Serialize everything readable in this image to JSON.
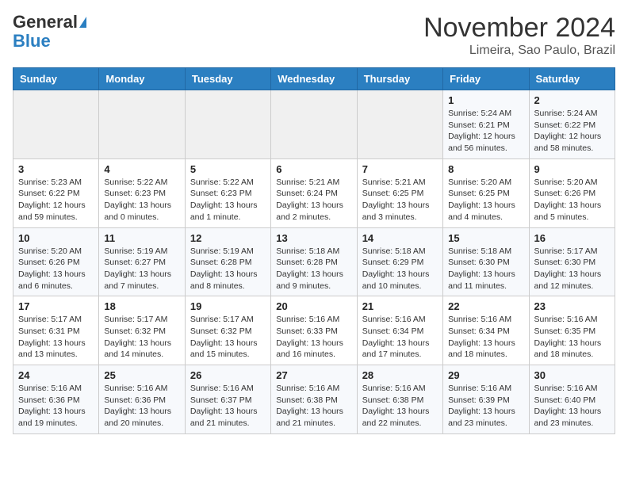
{
  "header": {
    "logo_line1": "General",
    "logo_line2": "Blue",
    "month": "November 2024",
    "location": "Limeira, Sao Paulo, Brazil"
  },
  "weekdays": [
    "Sunday",
    "Monday",
    "Tuesday",
    "Wednesday",
    "Thursday",
    "Friday",
    "Saturday"
  ],
  "weeks": [
    [
      {
        "day": "",
        "info": ""
      },
      {
        "day": "",
        "info": ""
      },
      {
        "day": "",
        "info": ""
      },
      {
        "day": "",
        "info": ""
      },
      {
        "day": "",
        "info": ""
      },
      {
        "day": "1",
        "info": "Sunrise: 5:24 AM\nSunset: 6:21 PM\nDaylight: 12 hours\nand 56 minutes."
      },
      {
        "day": "2",
        "info": "Sunrise: 5:24 AM\nSunset: 6:22 PM\nDaylight: 12 hours\nand 58 minutes."
      }
    ],
    [
      {
        "day": "3",
        "info": "Sunrise: 5:23 AM\nSunset: 6:22 PM\nDaylight: 12 hours\nand 59 minutes."
      },
      {
        "day": "4",
        "info": "Sunrise: 5:22 AM\nSunset: 6:23 PM\nDaylight: 13 hours\nand 0 minutes."
      },
      {
        "day": "5",
        "info": "Sunrise: 5:22 AM\nSunset: 6:23 PM\nDaylight: 13 hours\nand 1 minute."
      },
      {
        "day": "6",
        "info": "Sunrise: 5:21 AM\nSunset: 6:24 PM\nDaylight: 13 hours\nand 2 minutes."
      },
      {
        "day": "7",
        "info": "Sunrise: 5:21 AM\nSunset: 6:25 PM\nDaylight: 13 hours\nand 3 minutes."
      },
      {
        "day": "8",
        "info": "Sunrise: 5:20 AM\nSunset: 6:25 PM\nDaylight: 13 hours\nand 4 minutes."
      },
      {
        "day": "9",
        "info": "Sunrise: 5:20 AM\nSunset: 6:26 PM\nDaylight: 13 hours\nand 5 minutes."
      }
    ],
    [
      {
        "day": "10",
        "info": "Sunrise: 5:20 AM\nSunset: 6:26 PM\nDaylight: 13 hours\nand 6 minutes."
      },
      {
        "day": "11",
        "info": "Sunrise: 5:19 AM\nSunset: 6:27 PM\nDaylight: 13 hours\nand 7 minutes."
      },
      {
        "day": "12",
        "info": "Sunrise: 5:19 AM\nSunset: 6:28 PM\nDaylight: 13 hours\nand 8 minutes."
      },
      {
        "day": "13",
        "info": "Sunrise: 5:18 AM\nSunset: 6:28 PM\nDaylight: 13 hours\nand 9 minutes."
      },
      {
        "day": "14",
        "info": "Sunrise: 5:18 AM\nSunset: 6:29 PM\nDaylight: 13 hours\nand 10 minutes."
      },
      {
        "day": "15",
        "info": "Sunrise: 5:18 AM\nSunset: 6:30 PM\nDaylight: 13 hours\nand 11 minutes."
      },
      {
        "day": "16",
        "info": "Sunrise: 5:17 AM\nSunset: 6:30 PM\nDaylight: 13 hours\nand 12 minutes."
      }
    ],
    [
      {
        "day": "17",
        "info": "Sunrise: 5:17 AM\nSunset: 6:31 PM\nDaylight: 13 hours\nand 13 minutes."
      },
      {
        "day": "18",
        "info": "Sunrise: 5:17 AM\nSunset: 6:32 PM\nDaylight: 13 hours\nand 14 minutes."
      },
      {
        "day": "19",
        "info": "Sunrise: 5:17 AM\nSunset: 6:32 PM\nDaylight: 13 hours\nand 15 minutes."
      },
      {
        "day": "20",
        "info": "Sunrise: 5:16 AM\nSunset: 6:33 PM\nDaylight: 13 hours\nand 16 minutes."
      },
      {
        "day": "21",
        "info": "Sunrise: 5:16 AM\nSunset: 6:34 PM\nDaylight: 13 hours\nand 17 minutes."
      },
      {
        "day": "22",
        "info": "Sunrise: 5:16 AM\nSunset: 6:34 PM\nDaylight: 13 hours\nand 18 minutes."
      },
      {
        "day": "23",
        "info": "Sunrise: 5:16 AM\nSunset: 6:35 PM\nDaylight: 13 hours\nand 18 minutes."
      }
    ],
    [
      {
        "day": "24",
        "info": "Sunrise: 5:16 AM\nSunset: 6:36 PM\nDaylight: 13 hours\nand 19 minutes."
      },
      {
        "day": "25",
        "info": "Sunrise: 5:16 AM\nSunset: 6:36 PM\nDaylight: 13 hours\nand 20 minutes."
      },
      {
        "day": "26",
        "info": "Sunrise: 5:16 AM\nSunset: 6:37 PM\nDaylight: 13 hours\nand 21 minutes."
      },
      {
        "day": "27",
        "info": "Sunrise: 5:16 AM\nSunset: 6:38 PM\nDaylight: 13 hours\nand 21 minutes."
      },
      {
        "day": "28",
        "info": "Sunrise: 5:16 AM\nSunset: 6:38 PM\nDaylight: 13 hours\nand 22 minutes."
      },
      {
        "day": "29",
        "info": "Sunrise: 5:16 AM\nSunset: 6:39 PM\nDaylight: 13 hours\nand 23 minutes."
      },
      {
        "day": "30",
        "info": "Sunrise: 5:16 AM\nSunset: 6:40 PM\nDaylight: 13 hours\nand 23 minutes."
      }
    ]
  ]
}
